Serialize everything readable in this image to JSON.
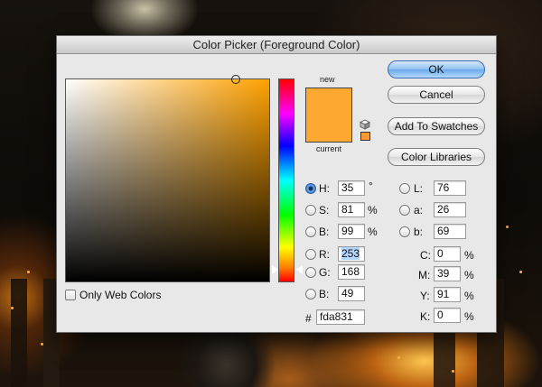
{
  "dialog": {
    "title": "Color Picker (Foreground Color)"
  },
  "preview": {
    "new_label": "new",
    "current_label": "current",
    "new_color": "#fda831",
    "current_color": "#fda831"
  },
  "buttons": {
    "ok": "OK",
    "cancel": "Cancel",
    "add_to_swatches": "Add To Swatches",
    "color_libraries": "Color Libraries"
  },
  "hsb": [
    {
      "label": "H:",
      "value": "35",
      "unit": "°",
      "selected": true
    },
    {
      "label": "S:",
      "value": "81",
      "unit": "%",
      "selected": false
    },
    {
      "label": "B:",
      "value": "99",
      "unit": "%",
      "selected": false
    }
  ],
  "rgb": [
    {
      "label": "R:",
      "value": "253",
      "selected": false
    },
    {
      "label": "G:",
      "value": "168",
      "selected": false
    },
    {
      "label": "B:",
      "value": "49",
      "selected": false
    }
  ],
  "lab": [
    {
      "label": "L:",
      "value": "76"
    },
    {
      "label": "a:",
      "value": "26"
    },
    {
      "label": "b:",
      "value": "69"
    }
  ],
  "cmyk": [
    {
      "label": "C:",
      "value": "0",
      "unit": "%"
    },
    {
      "label": "M:",
      "value": "39",
      "unit": "%"
    },
    {
      "label": "Y:",
      "value": "91",
      "unit": "%"
    },
    {
      "label": "K:",
      "value": "0",
      "unit": "%"
    }
  ],
  "hex": {
    "label": "#",
    "value": "fda831"
  },
  "only_web_colors": {
    "label": "Only Web Colors",
    "checked": false
  },
  "colors": {
    "field_hue": "#ffa100",
    "accent": "#6aa9ec"
  }
}
